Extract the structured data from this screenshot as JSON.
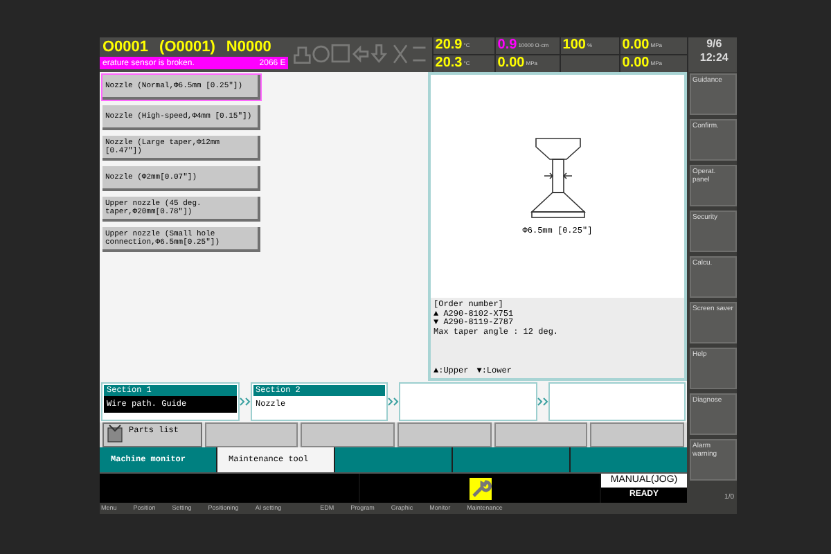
{
  "header": {
    "program": "O0001",
    "program_sub": "(O0001)",
    "sequence": "N0000",
    "alarm": "erature sensor is broken.",
    "alarm_code": "2066 E",
    "readings": [
      {
        "kind": "value",
        "value": "20.9",
        "unit": "°C",
        "color": "#ffff00"
      },
      {
        "kind": "value",
        "value": "0.9",
        "unit": "10000 Ω·cm",
        "color": "#ff00ff"
      },
      {
        "kind": "value",
        "value": "100",
        "unit": "%",
        "color": "#ffff00"
      },
      {
        "kind": "value",
        "value": "0.00",
        "unit": "MPa",
        "color": "#ffff00"
      },
      {
        "kind": "value",
        "value": "20.3",
        "unit": "°C",
        "color": "#ffff00"
      },
      {
        "kind": "value",
        "value": "0.00",
        "unit": "MPa",
        "color": "#ffff00"
      },
      {
        "kind": "blank"
      },
      {
        "kind": "value",
        "value": "0.00",
        "unit": "MPa",
        "color": "#ffff00"
      }
    ],
    "date": "9/6",
    "time": "12:24"
  },
  "nozzles": [
    {
      "label": "Nozzle (Normal,Φ6.5mm [0.25\"])",
      "selected": true
    },
    {
      "label": "Nozzle (High-speed,Φ4mm [0.15\"])",
      "selected": false
    },
    {
      "label": "Nozzle (Large taper,Φ12mm [0.47\"])",
      "selected": false
    },
    {
      "label": "Nozzle (Φ2mm[0.07\"])",
      "selected": false
    },
    {
      "label": "Upper nozzle (45 deg. taper,Φ20mm[0.78\"])",
      "selected": false
    },
    {
      "label": "Upper nozzle (Small hole connection,Φ6.5mm[0.25\"])",
      "selected": false
    }
  ],
  "diagram": {
    "dimension": "Φ6.5mm [0.25\"]",
    "info": [
      "[Order number]",
      "▲ A290-8102-X751",
      "▼ A290-8119-Z787",
      "Max taper angle : 12 deg."
    ],
    "legend": [
      "▲:Upper",
      "▼:Lower"
    ]
  },
  "sections": [
    {
      "kind": "filled",
      "title": "Section 1",
      "value": "Wire path. Guide",
      "selected": true
    },
    {
      "kind": "filled",
      "title": "Section 2",
      "value": "Nozzle",
      "selected": false
    },
    {
      "kind": "blank"
    },
    {
      "kind": "blank"
    }
  ],
  "soft_keys": [
    {
      "kind": "icon",
      "label": "Parts list"
    },
    {
      "kind": "blank"
    },
    {
      "kind": "blank"
    },
    {
      "kind": "blank"
    },
    {
      "kind": "blank"
    },
    {
      "kind": "blank"
    }
  ],
  "tabs": [
    {
      "kind": "text",
      "label": "Machine monitor",
      "selected": false
    },
    {
      "kind": "text",
      "label": "Maintenance tool",
      "selected": true
    },
    {
      "kind": "blank",
      "selected": false
    },
    {
      "kind": "blank",
      "selected": false
    },
    {
      "kind": "blank",
      "selected": false
    }
  ],
  "status": {
    "mode": "MANUAL(JOG)",
    "state": "READY"
  },
  "side_buttons": [
    "Guidance",
    "Confirm.",
    "Operat. panel",
    "Security",
    "Calcu.",
    "Screen saver",
    "Help",
    "Diagnose",
    "Alarm warning"
  ],
  "page": "1/0",
  "menu": [
    "Menu",
    "Position",
    "Setting",
    "Positioning",
    "AI setting",
    "EDM",
    "Program",
    "Graphic",
    "Monitor",
    "Maintenance"
  ]
}
